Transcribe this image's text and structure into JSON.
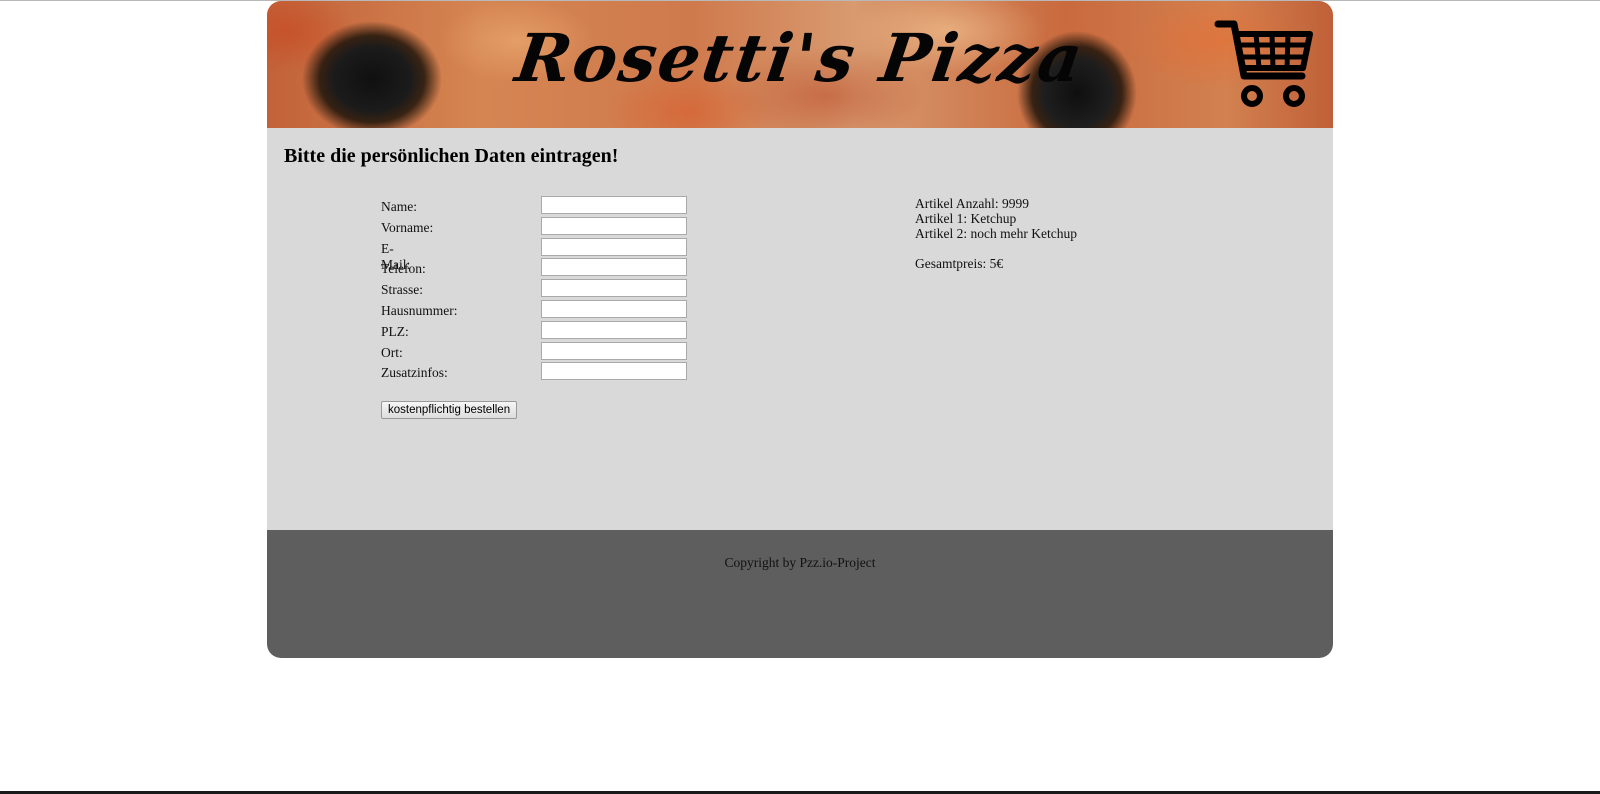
{
  "header": {
    "logo_text": "Rosetti's Pizza",
    "cart_icon": "shopping-cart-icon"
  },
  "main": {
    "heading": "Bitte die persönlichen Daten eintragen!",
    "form": {
      "fields": [
        {
          "label": "Name:",
          "value": ""
        },
        {
          "label": "Vorname:",
          "value": ""
        },
        {
          "label": "E-Mail:",
          "value": ""
        },
        {
          "label": "Telefon:",
          "value": ""
        },
        {
          "label": "Strasse:",
          "value": ""
        },
        {
          "label": "Hausnummer:",
          "value": ""
        },
        {
          "label": "PLZ:",
          "value": ""
        },
        {
          "label": "Ort:",
          "value": ""
        },
        {
          "label": "Zusatzinfos:",
          "value": ""
        }
      ],
      "submit_label": "kostenpflichtig bestellen"
    },
    "summary": {
      "article_count": "Artikel Anzahl: 9999",
      "article_1": "Artikel 1: Ketchup",
      "article_2": "Artikel 2: noch mehr Ketchup",
      "total_price": "Gesamtpreis: 5€"
    }
  },
  "footer": {
    "copyright": "Copyright by Pzz.io-Project"
  },
  "colors": {
    "main_background": "#d9d9d9",
    "footer_background": "#5e5e5e"
  }
}
